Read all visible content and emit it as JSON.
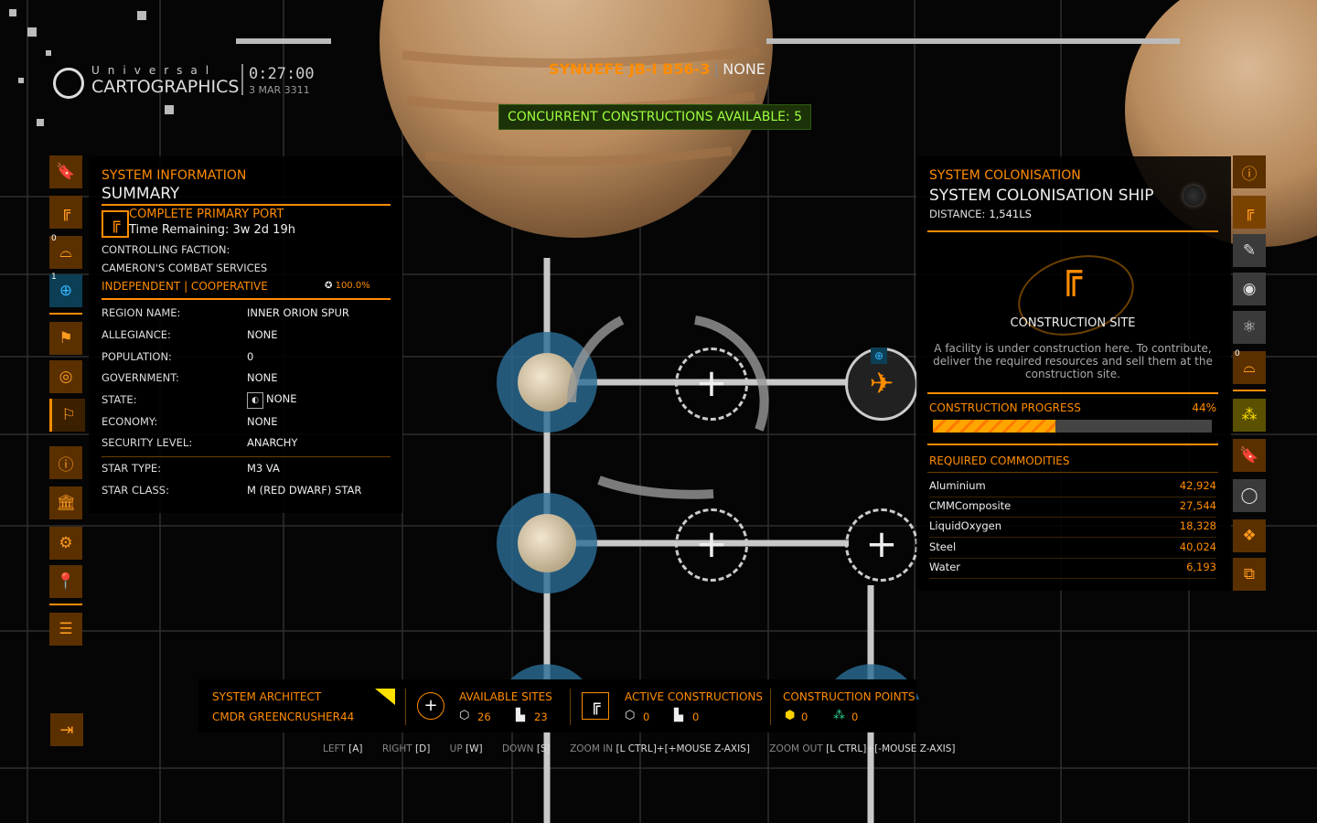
{
  "header": {
    "brand_top": "Universal",
    "brand_main": "CARTOGRAPHICS",
    "clock": "0:27:00",
    "date": "3 MAR 3311",
    "system_name": "SYNUEFE JB-I B56-3",
    "system_status": "NONE",
    "concurrent": "CONCURRENT CONSTRUCTIONS AVAILABLE: 5"
  },
  "left_sidebar": {
    "badges": {
      "row3": "0",
      "row4": "1"
    },
    "icons": [
      "bookmark-icon",
      "crane-icon",
      "planet-landing-icon",
      "globe-icon",
      "traffic-icon",
      "target-icon",
      "flag-icon",
      "info-icon",
      "bank-icon",
      "gear-icon",
      "map-pin-icon",
      "list-icon"
    ]
  },
  "system_info": {
    "category": "SYSTEM INFORMATION",
    "title": "SUMMARY",
    "port_name": "COMPLETE PRIMARY PORT",
    "port_time": "Time Remaining: 3w 2d 19h",
    "faction_label": "CONTROLLING FACTION:",
    "faction_name": "CAMERON'S COMBAT SERVICES",
    "faction_allegiance": "INDEPENDENT | COOPERATIVE",
    "faction_influence": "100.0%",
    "rows": [
      {
        "label": "REGION NAME:",
        "value": "INNER ORION SPUR"
      },
      {
        "label": "ALLEGIANCE:",
        "value": "NONE"
      },
      {
        "label": "POPULATION:",
        "value": "0"
      },
      {
        "label": "GOVERNMENT:",
        "value": "NONE"
      },
      {
        "label": "STATE:",
        "value": "NONE"
      },
      {
        "label": "ECONOMY:",
        "value": "NONE"
      },
      {
        "label": "SECURITY LEVEL:",
        "value": "ANARCHY"
      }
    ],
    "star_rows": [
      {
        "label": "STAR TYPE:",
        "value": "M3 VA"
      },
      {
        "label": "STAR CLASS:",
        "value": "M (RED DWARF) STAR"
      }
    ]
  },
  "colonisation": {
    "category": "SYSTEM COLONISATION",
    "title": "SYSTEM COLONISATION SHIP",
    "distance_label": "DISTANCE:",
    "distance_value": "1,541LS",
    "site_name": "CONSTRUCTION SITE",
    "site_desc": "A facility is under construction here. To contribute, deliver the required resources and sell them at the construction site.",
    "progress_label": "CONSTRUCTION PROGRESS",
    "progress_text": "44%",
    "progress_value": 0.44,
    "required_label": "REQUIRED COMMODITIES",
    "commodities": [
      {
        "name": "Aluminium",
        "qty": "42,924"
      },
      {
        "name": "CMMComposite",
        "qty": "27,544"
      },
      {
        "name": "LiquidOxygen",
        "qty": "18,328"
      },
      {
        "name": "Steel",
        "qty": "40,024"
      },
      {
        "name": "Water",
        "qty": "6,193"
      }
    ]
  },
  "right_sidebar": {
    "badge": "0",
    "icons": [
      "info-icon",
      "construction-icon",
      "edit-planet-icon",
      "target-icon",
      "dna-icon",
      "planet-landing-icon",
      "network-icon",
      "bookmark-icon",
      "ring-icon",
      "nodes-icon",
      "swap-icon"
    ]
  },
  "bottom_bar": {
    "architect_label": "SYSTEM ARCHITECT",
    "architect_name": "CMDR GREENCRUSHER44",
    "available_label": "AVAILABLE SITES",
    "available_orbital": "26",
    "available_surface": "23",
    "active_label": "ACTIVE CONSTRUCTIONS",
    "active_orbital": "0",
    "active_surface": "0",
    "points_label": "CONSTRUCTION POINTS",
    "points_t2": "0",
    "points_t3": "0"
  },
  "key_hints": [
    {
      "label": "LEFT",
      "key": "[A]"
    },
    {
      "label": "RIGHT",
      "key": "[D]"
    },
    {
      "label": "UP",
      "key": "[W]"
    },
    {
      "label": "DOWN",
      "key": "[S]"
    },
    {
      "label": "ZOOM IN",
      "key": "[L CTRL]+[+MOUSE Z-AXIS]"
    },
    {
      "label": "ZOOM OUT",
      "key": "[L CTRL]+[-MOUSE Z-AXIS]"
    }
  ]
}
